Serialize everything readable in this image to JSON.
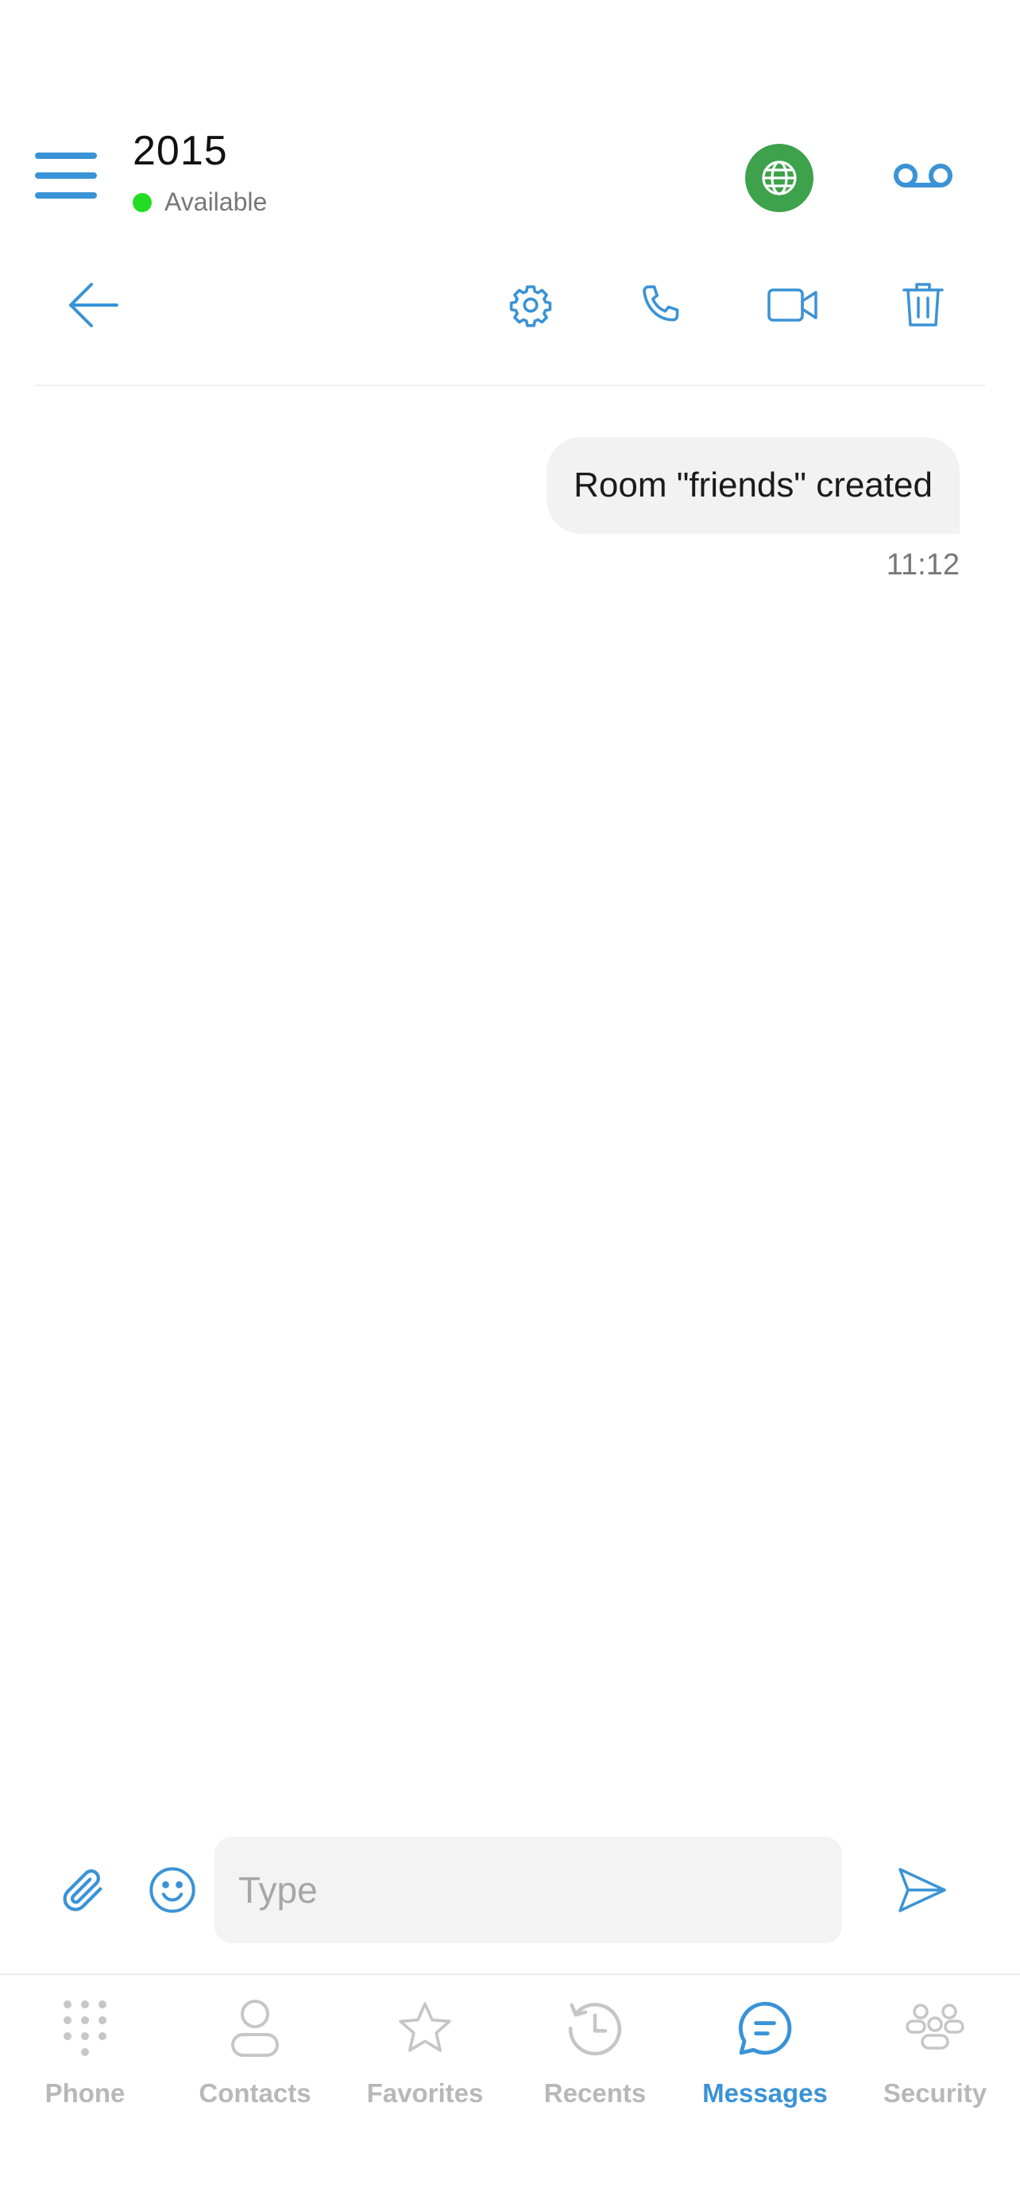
{
  "header": {
    "title": "2015",
    "status": "Available",
    "status_color": "#22dd22",
    "globe_color": "#3da24b",
    "accent": "#3a93d6"
  },
  "toolbar": {
    "icons": [
      "back-arrow-icon",
      "gear-icon",
      "phone-icon",
      "video-camera-icon",
      "trash-icon"
    ]
  },
  "conversation": {
    "messages": [
      {
        "text": "Room \"friends\" created",
        "time": "11:12"
      }
    ]
  },
  "composer": {
    "placeholder": "Type",
    "value": ""
  },
  "bottom_nav": {
    "active": "Messages",
    "items": [
      {
        "label": "Phone",
        "icon": "dialpad-icon"
      },
      {
        "label": "Contacts",
        "icon": "person-icon"
      },
      {
        "label": "Favorites",
        "icon": "star-icon"
      },
      {
        "label": "Recents",
        "icon": "history-icon"
      },
      {
        "label": "Messages",
        "icon": "chat-bubble-icon"
      },
      {
        "label": "Security",
        "icon": "people-group-icon"
      }
    ]
  }
}
